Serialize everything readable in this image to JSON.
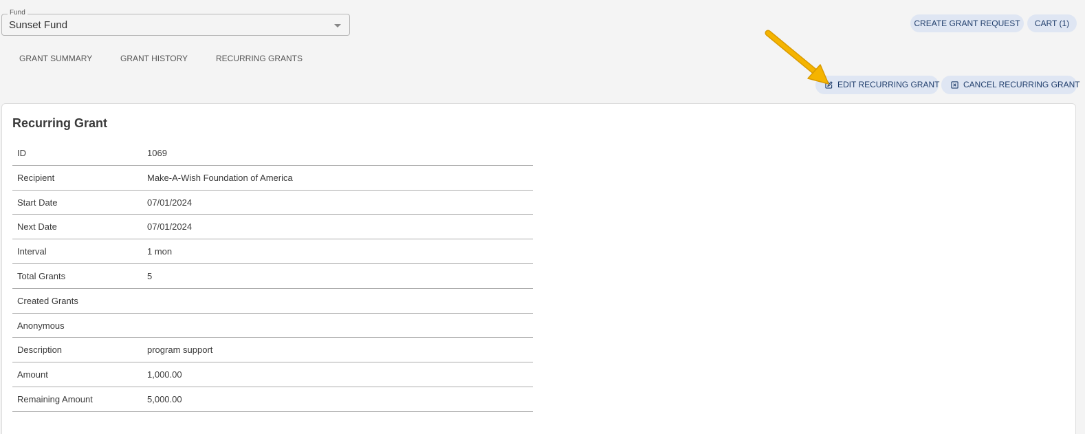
{
  "fund": {
    "label": "Fund",
    "value": "Sunset Fund"
  },
  "header_actions": {
    "create_grant_request": "CREATE GRANT REQUEST",
    "cart": "CART (1)"
  },
  "tabs": [
    {
      "label": "GRANT SUMMARY"
    },
    {
      "label": "GRANT HISTORY"
    },
    {
      "label": "RECURRING GRANTS"
    }
  ],
  "actions": {
    "edit": "EDIT RECURRING GRANT",
    "cancel": "CANCEL RECURRING GRANT"
  },
  "card": {
    "title": "Recurring Grant",
    "rows": [
      {
        "label": "ID",
        "value": "1069"
      },
      {
        "label": "Recipient",
        "value": "Make-A-Wish Foundation of America"
      },
      {
        "label": "Start Date",
        "value": "07/01/2024"
      },
      {
        "label": "Next Date",
        "value": "07/01/2024"
      },
      {
        "label": "Interval",
        "value": "1 mon"
      },
      {
        "label": "Total Grants",
        "value": "5"
      },
      {
        "label": "Created Grants",
        "value": ""
      },
      {
        "label": "Anonymous",
        "value": ""
      },
      {
        "label": "Description",
        "value": "program support"
      },
      {
        "label": "Amount",
        "value": "1,000.00"
      },
      {
        "label": "Remaining Amount",
        "value": "5,000.00"
      }
    ]
  },
  "colors": {
    "background": "#f4f4f4",
    "pill_bg": "#dfe6f3",
    "pill_text": "#1f3d6b",
    "annotation_arrow": "#f5b400"
  },
  "icons": {
    "edit": "edit-icon",
    "cancel": "close-box-icon",
    "dropdown": "chevron-down-icon"
  }
}
